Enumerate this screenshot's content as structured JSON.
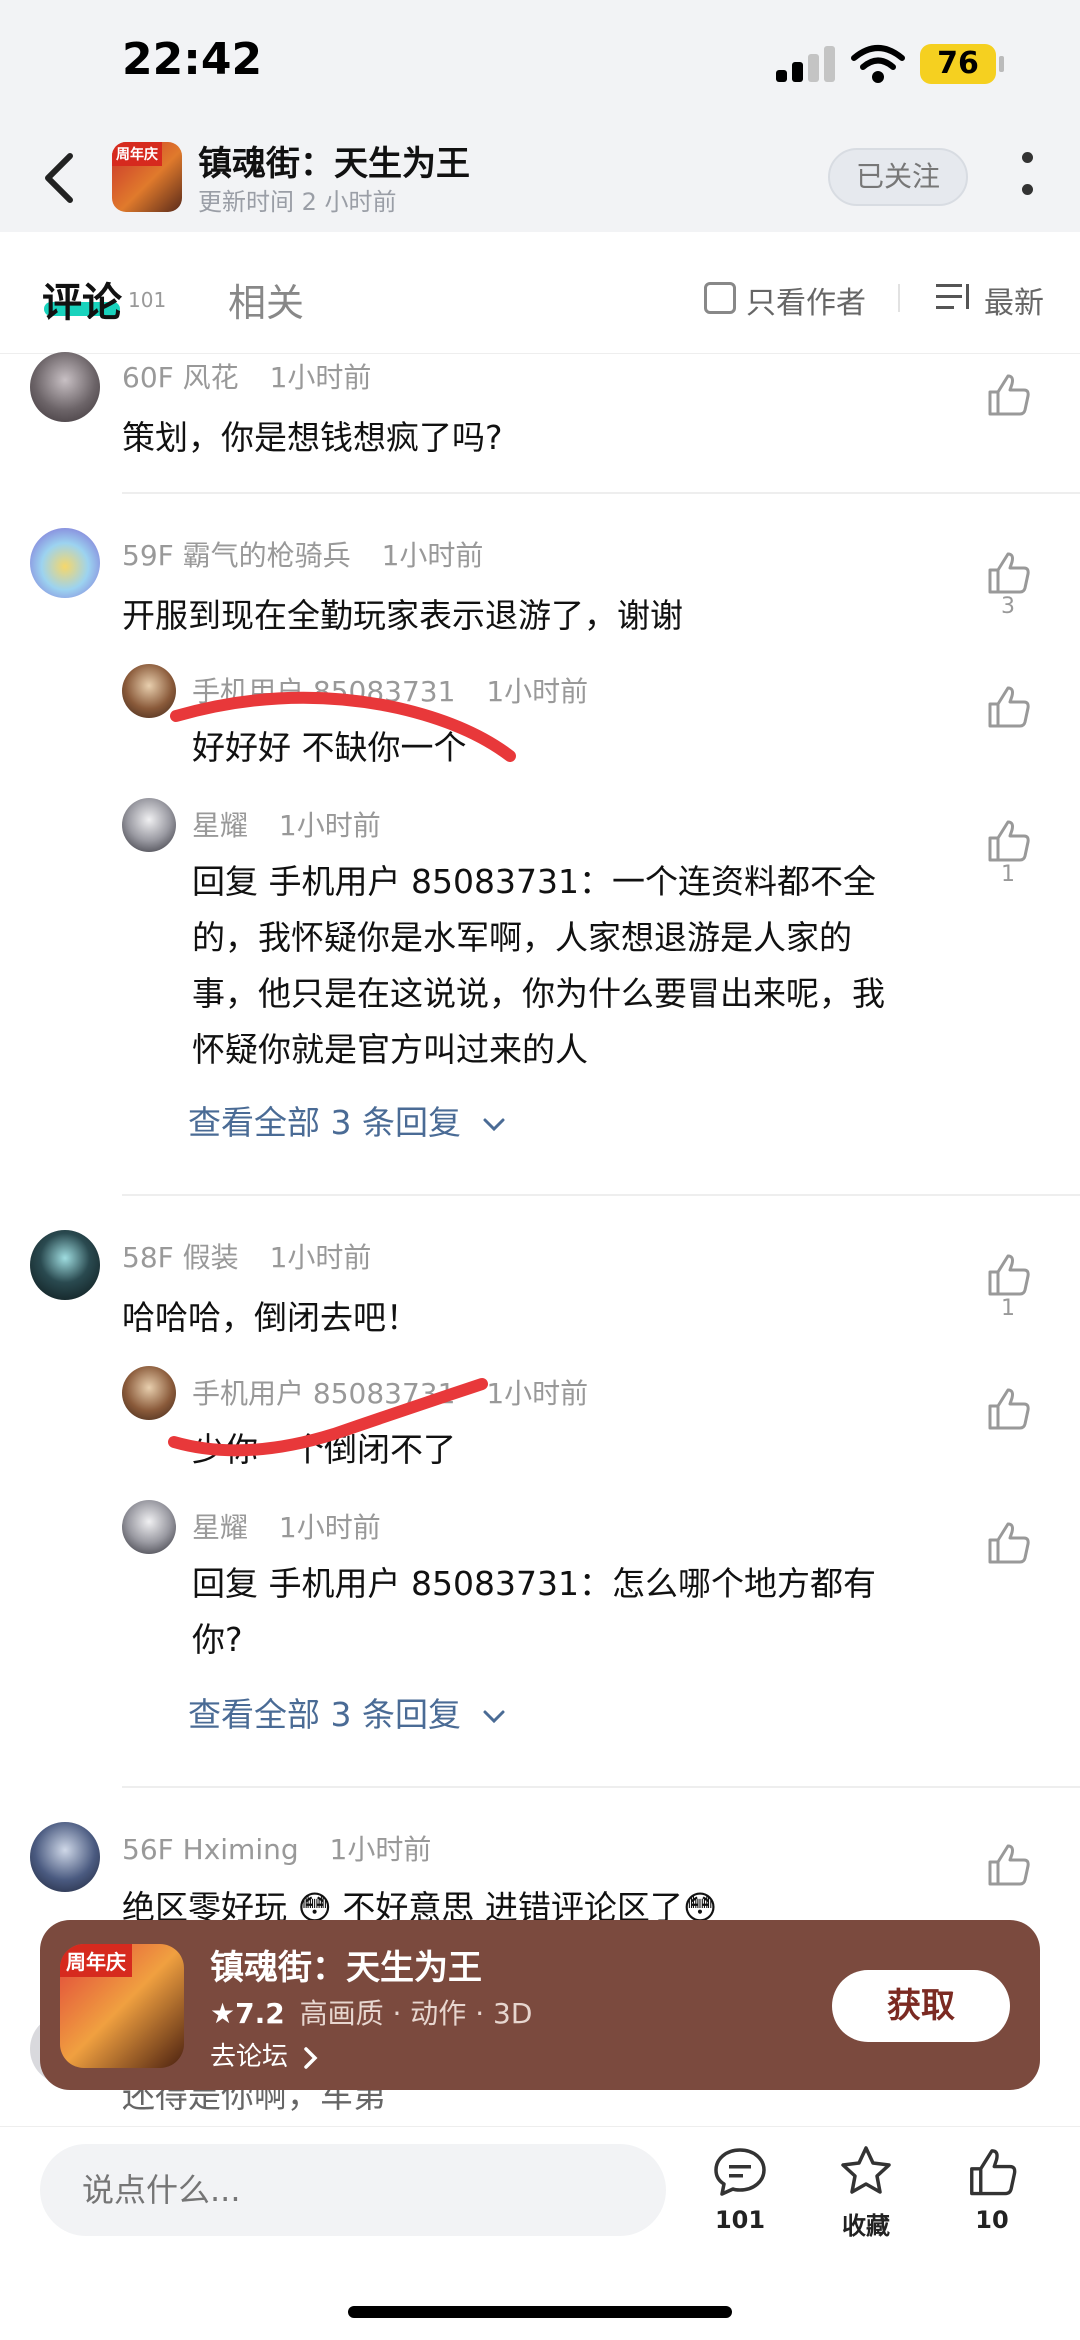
{
  "status_bar": {
    "time": "22:42",
    "battery": "76"
  },
  "header": {
    "title": "镇魂街：天生为王",
    "subtitle": "更新时间 2 小时前",
    "follow_label": "已关注",
    "avatar_tag": "周年庆"
  },
  "tabs": {
    "comments_label": "评论",
    "comments_count": "101",
    "related_label": "相关",
    "only_author_label": "只看作者",
    "sort_label": "最新"
  },
  "comments": [
    {
      "floor": "60F",
      "user": "风花",
      "time": "1小时前",
      "text": "策划，你是想钱想疯了吗?",
      "likes": ""
    },
    {
      "floor": "59F",
      "user": "霸气的枪骑兵",
      "time": "1小时前",
      "text": "开服到现在全勤玩家表示退游了，谢谢",
      "likes": "3",
      "replies": [
        {
          "user": "手机用户 85083731",
          "time": "1小时前",
          "text": "好好好 不缺你一个",
          "likes": ""
        },
        {
          "user": "星耀",
          "time": "1小时前",
          "lines": [
            "回复 手机用户 85083731：一个连资料都不全",
            "的，我怀疑你是水军啊，人家想退游是人家的",
            "事，他只是在这说说，你为什么要冒出来呢，我",
            "怀疑你就是官方叫过来的人"
          ],
          "likes": "1"
        }
      ],
      "view_all": "查看全部 3 条回复"
    },
    {
      "floor": "58F",
      "user": "假装",
      "time": "1小时前",
      "text": "哈哈哈，倒闭去吧！",
      "likes": "1",
      "replies": [
        {
          "user": "手机用户 85083731",
          "time": "1小时前",
          "text": "少你一个倒闭不了",
          "likes": ""
        },
        {
          "user": "星耀",
          "time": "1小时前",
          "lines": [
            "回复 手机用户 85083731：怎么哪个地方都有",
            "你?"
          ],
          "likes": ""
        }
      ],
      "view_all": "查看全部 3 条回复"
    },
    {
      "floor": "56F",
      "user": "Hximing",
      "time": "1小时前",
      "text": "绝区零好玩 😳 不好意思 进错评论区了😳",
      "likes": ""
    }
  ],
  "partial_comment": "还得是你啊，车第",
  "promo": {
    "title": "镇魂街：天生为王",
    "rating": "★7.2",
    "tags": "高画质 · 动作 · 3D",
    "forum_label": "去论坛",
    "get_label": "获取",
    "icon_tag": "周年庆"
  },
  "bottom_bar": {
    "input_placeholder": "说点什么...",
    "comments_count": "101",
    "favorite_label": "收藏",
    "likes_count": "10"
  },
  "colors": {
    "accent_teal": "#19d3bd",
    "promo_bg": "#7b4a3e",
    "link_blue": "#4a6b95",
    "strike_red": "#e8383a"
  }
}
